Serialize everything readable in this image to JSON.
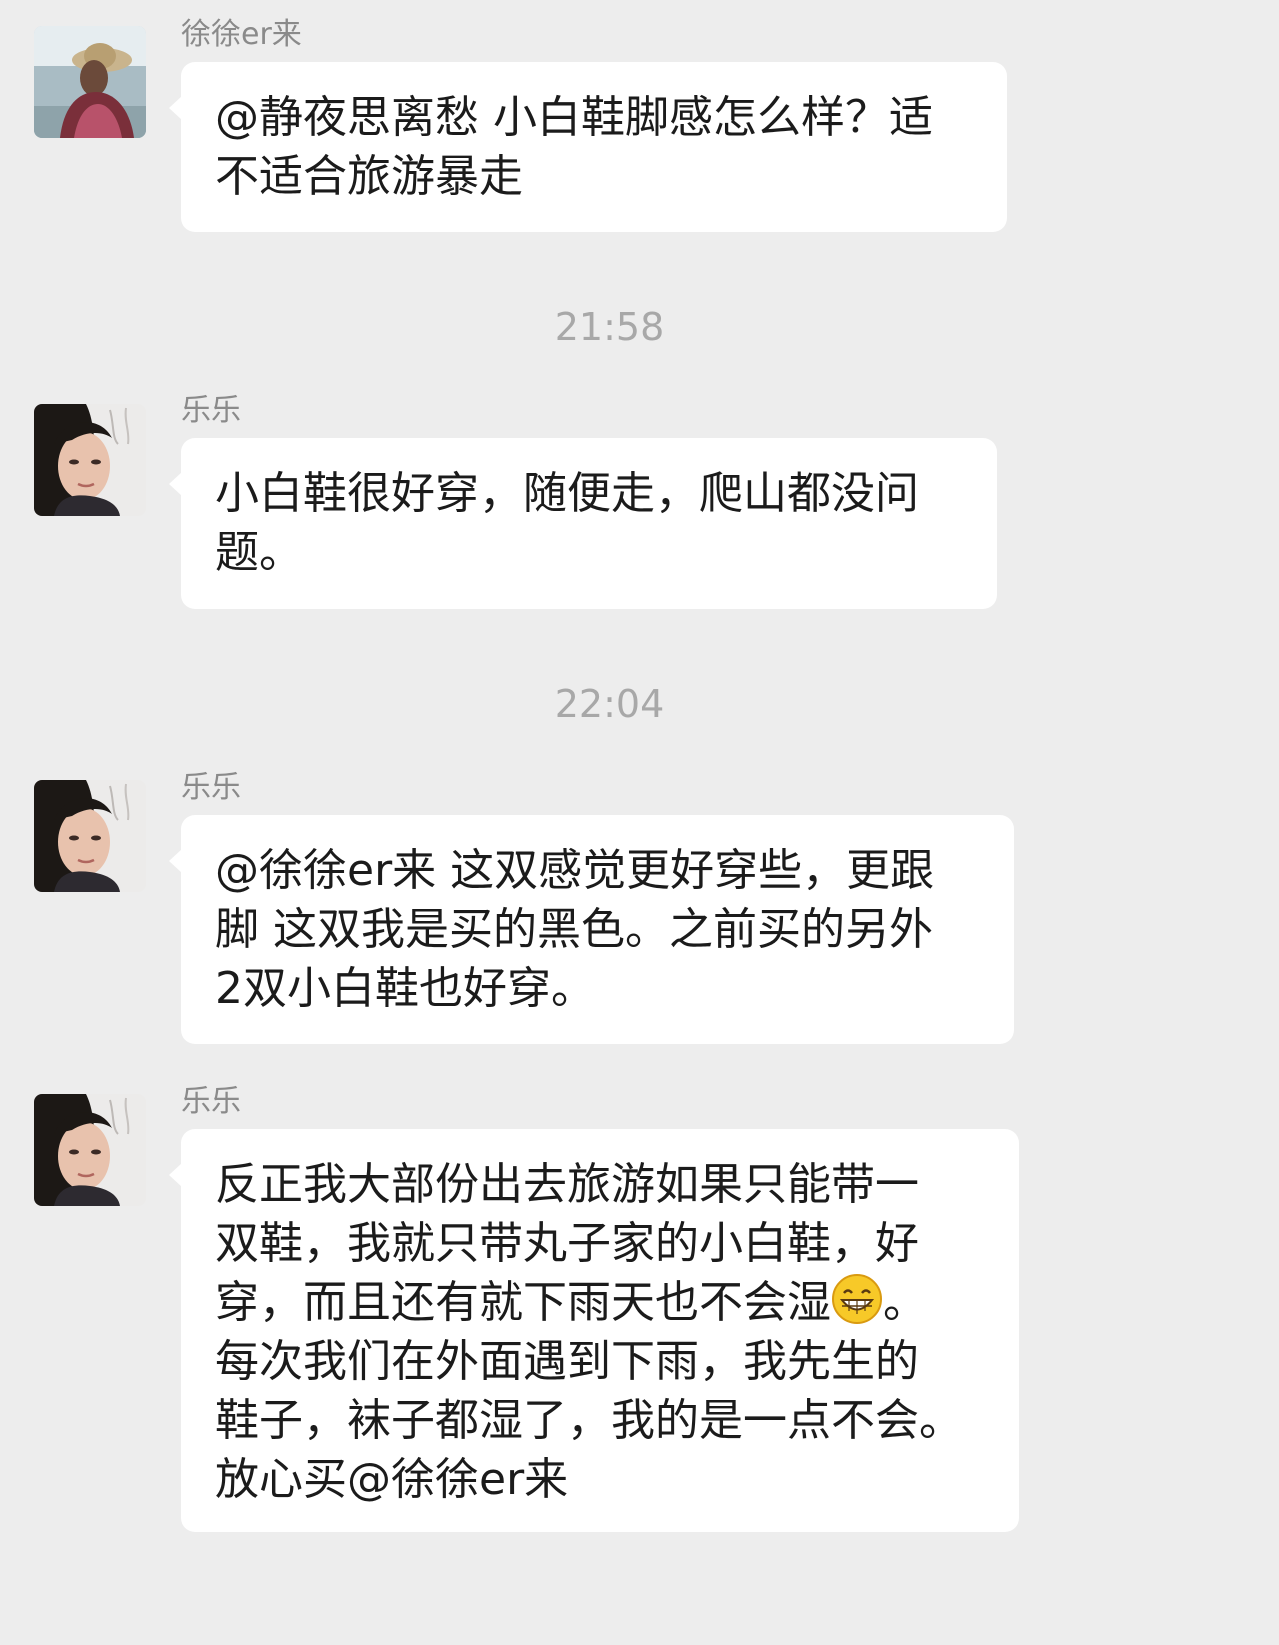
{
  "messages": [
    {
      "sender": "徐徐er来",
      "text": "@静夜思离愁 小白鞋脚感怎么样？适\n不适合旅游暴走"
    },
    {
      "sender": "乐乐",
      "text": "小白鞋很好穿，随便走，爬山都没问\n题。"
    },
    {
      "sender": "乐乐",
      "text": "@徐徐er来 这双感觉更好穿些，更跟\n脚 这双我是买的黑色。之前买的另外\n2双小白鞋也好穿。"
    },
    {
      "sender": "乐乐",
      "text_before_emoji": "反正我大部份出去旅游如果只能带一\n双鞋，我就只带丸子家的小白鞋，好\n穿，而且还有就下雨天也不会湿",
      "emoji": "grinning-face-emoji",
      "text_after_emoji": "。\n每次我们在外面遇到下雨，我先生的\n鞋子，袜子都湿了，我的是一点不会。\n放心买@徐徐er来"
    }
  ],
  "timestamps": [
    "21:58",
    "22:04"
  ]
}
